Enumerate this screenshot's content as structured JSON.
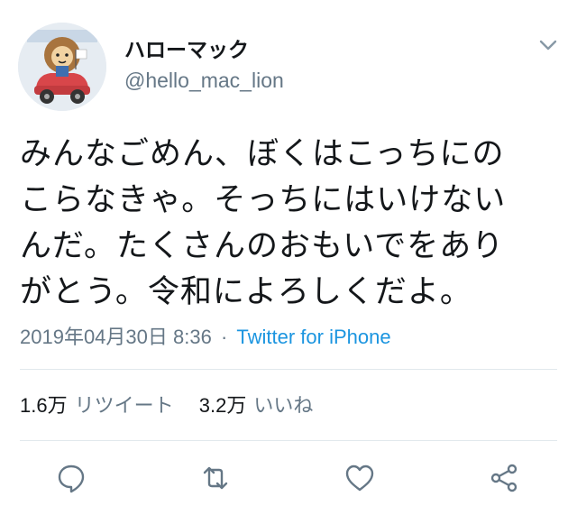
{
  "user": {
    "display_name": "ハローマック",
    "handle": "@hello_mac_lion",
    "avatar_icon": "lion-mascot-avatar"
  },
  "tweet": {
    "lines": [
      "みんなごめん、ぼくはこっちにの",
      "こらなきゃ。そっちにはいけない",
      "んだ。たくさんのおもいでをあり",
      "がとう。令和によろしくだよ。"
    ],
    "timestamp": "2019年04月30日 8:36",
    "separator": "·",
    "source": "Twitter for iPhone"
  },
  "stats": {
    "retweets_count": "1.6万",
    "retweets_label": "リツイート",
    "likes_count": "3.2万",
    "likes_label": "いいね"
  },
  "actions": [
    "reply-icon",
    "retweet-icon",
    "like-icon",
    "share-icon"
  ],
  "colors": {
    "text": "#14171a",
    "secondary": "#657786",
    "link": "#1b95e0",
    "divider": "#e1e8ed"
  }
}
